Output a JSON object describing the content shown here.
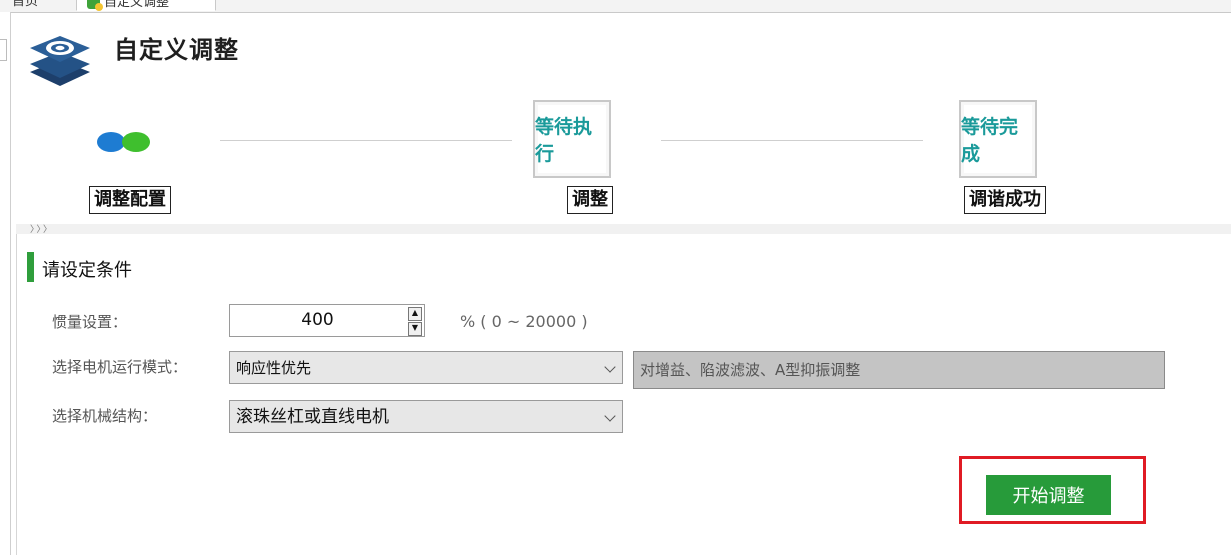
{
  "tabs": [
    {
      "label": "首页"
    },
    {
      "label": "自定义调整"
    }
  ],
  "header": {
    "title": "自定义调整"
  },
  "steps": {
    "step1_label": "调整配置",
    "step2_box": "等待执行",
    "step2_label": "调整",
    "step3_box": "等待完成",
    "step3_label": "调谐成功"
  },
  "band_text": "〉〉〉",
  "section": {
    "title": "请设定条件"
  },
  "form": {
    "inertia_label": "惯量设置：",
    "inertia_value": "400",
    "inertia_range": "% ( 0 ~ 20000 )",
    "mode_label": "选择电机运行模式：",
    "mode_value": "响应性优先",
    "mode_desc": "对增益、陷波滤波、A型抑振调整",
    "mech_label": "选择机械结构：",
    "mech_value": "滚珠丝杠或直线电机"
  },
  "actions": {
    "start_label": "开始调整"
  },
  "colors": {
    "accent_green": "#279b3a",
    "step_text": "#1a9a9a",
    "highlight_red": "#e01b24",
    "dot_blue": "#1e7cd2",
    "dot_green": "#3fbf2e"
  },
  "icons": {
    "logo": "layers-stack-icon",
    "spin_up": "caret-up-icon",
    "spin_down": "caret-down-icon",
    "dropdown": "chevron-down-icon"
  }
}
